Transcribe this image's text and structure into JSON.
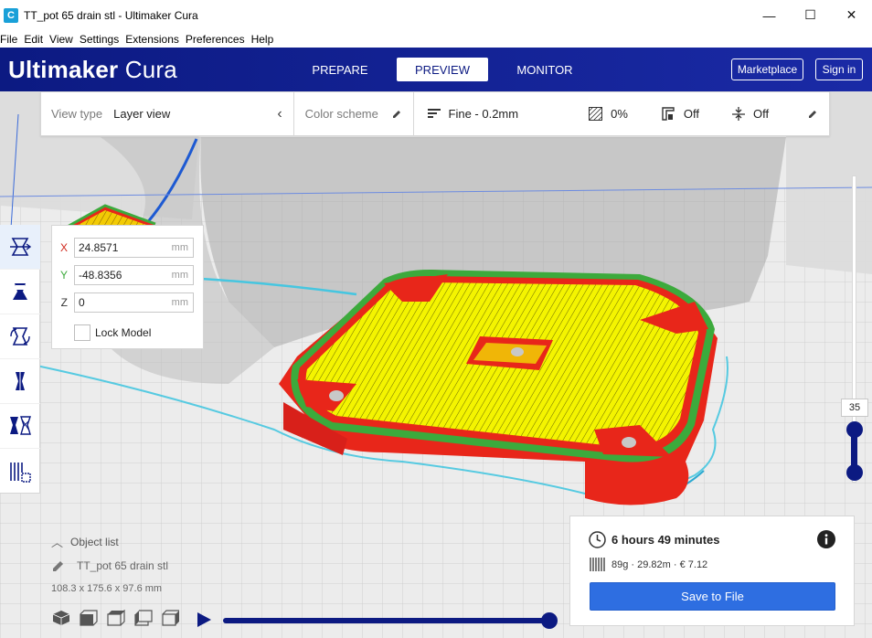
{
  "window": {
    "title": "TT_pot 65 drain stl - Ultimaker Cura",
    "app_icon": "C",
    "minimize_glyph": "—",
    "maximize_glyph": "☐",
    "close_glyph": "✕"
  },
  "menu": [
    "File",
    "Edit",
    "View",
    "Settings",
    "Extensions",
    "Preferences",
    "Help"
  ],
  "header": {
    "brand_bold": "Ultimaker",
    "brand_light": "Cura",
    "tabs": [
      {
        "label": "PREPARE",
        "active": false
      },
      {
        "label": "PREVIEW",
        "active": true
      },
      {
        "label": "MONITOR",
        "active": false
      }
    ],
    "marketplace_label": "Marketplace",
    "signin_label": "Sign in"
  },
  "toolbar": {
    "view_type_label": "View type",
    "view_type_value": "Layer view",
    "color_scheme_label": "Color scheme",
    "profile_value": "Fine - 0.2mm",
    "infill_value": "0%",
    "support_value": "Off",
    "adhesion_value": "Off"
  },
  "move_panel": {
    "x_label": "X",
    "x_value": "24.8571",
    "y_label": "Y",
    "y_value": "-48.8356",
    "z_label": "Z",
    "z_value": "0",
    "unit": "mm",
    "lock_label": "Lock Model"
  },
  "layer_slider": {
    "current_layer": "35"
  },
  "object_list": {
    "toggle_label": "Object list",
    "object_name": "TT_pot 65 drain stl",
    "dimensions": "108.3 x 175.6 x 97.6 mm"
  },
  "print_info": {
    "time": "6 hours 49 minutes",
    "details": "89g · 29.82m · € 7.12",
    "save_label": "Save to File"
  },
  "colors": {
    "brand_blue": "#0c1a82",
    "save_button": "#2e6ee1",
    "wall_red": "#e8261a",
    "top_yellow": "#f2f200",
    "inner_green": "#3caa3c",
    "travel_cyan": "#3ec8e0"
  }
}
